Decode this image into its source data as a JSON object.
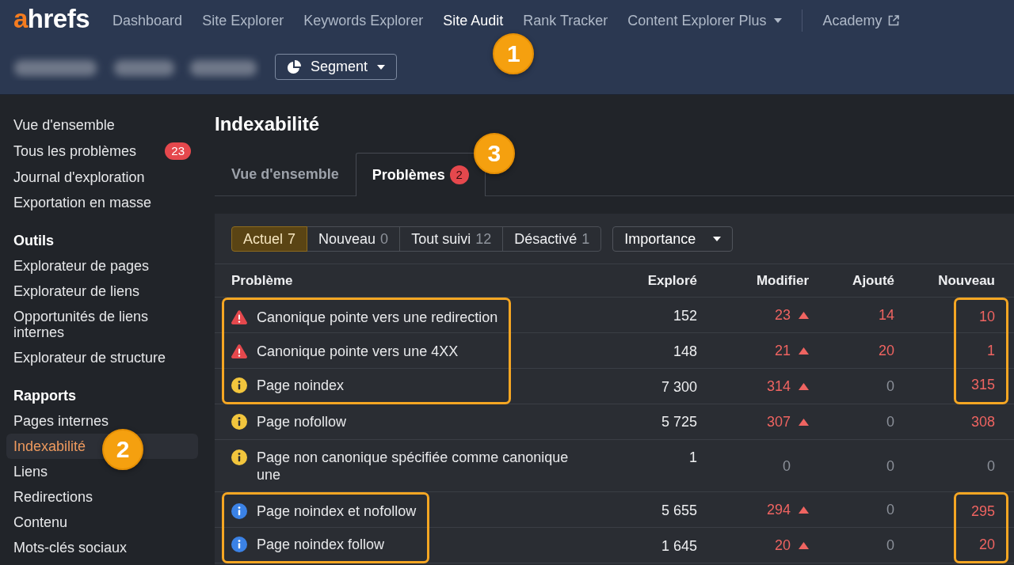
{
  "header": {
    "logo": {
      "accent": "a",
      "rest": "hrefs"
    },
    "nav": [
      {
        "label": "Dashboard",
        "kind": "link",
        "selected": false
      },
      {
        "label": "Site Explorer",
        "kind": "link",
        "selected": false
      },
      {
        "label": "Keywords Explorer",
        "kind": "link",
        "selected": false
      },
      {
        "label": "Site Audit",
        "kind": "link",
        "selected": true,
        "callout": "1"
      },
      {
        "label": "Rank Tracker",
        "kind": "link",
        "selected": false
      },
      {
        "label": "Content Explorer Plus",
        "kind": "dropdown",
        "selected": false
      },
      {
        "label": "Academy",
        "kind": "external",
        "selected": false
      }
    ],
    "segment_button": {
      "label": "Segment"
    }
  },
  "sidebar": {
    "sections": [
      {
        "items": [
          {
            "label": "Vue d'ensemble",
            "selected": false
          },
          {
            "label": "Tous les problèmes",
            "selected": false,
            "badge": "23"
          },
          {
            "label": "Journal d'exploration",
            "selected": false
          },
          {
            "label": "Exportation en masse",
            "selected": false
          }
        ]
      },
      {
        "title": "Outils",
        "items": [
          {
            "label": "Explorateur de pages",
            "selected": false
          },
          {
            "label": "Explorateur de liens",
            "selected": false
          },
          {
            "label": "Opportunités de liens internes",
            "selected": false
          },
          {
            "label": "Explorateur de structure",
            "selected": false
          }
        ]
      },
      {
        "title": "Rapports",
        "items": [
          {
            "label": "Pages internes",
            "selected": false
          },
          {
            "label": "Indexabilité",
            "selected": true,
            "callout": "2"
          },
          {
            "label": "Liens",
            "selected": false
          },
          {
            "label": "Redirections",
            "selected": false
          },
          {
            "label": "Contenu",
            "selected": false
          },
          {
            "label": "Mots-clés sociaux",
            "selected": false
          }
        ]
      }
    ]
  },
  "page_title": "Indexabilité",
  "tabs": [
    {
      "label": "Vue d'ensemble",
      "selected": false
    },
    {
      "label": "Problèmes",
      "selected": true,
      "badge": "2",
      "callout": "3"
    }
  ],
  "filters": [
    {
      "label": "Actuel",
      "count": "7",
      "selected": true
    },
    {
      "label": "Nouveau",
      "count": "0",
      "selected": false
    },
    {
      "label": "Tout suivi",
      "count": "12",
      "selected": false
    },
    {
      "label": "Désactivé",
      "count": "1",
      "selected": false
    }
  ],
  "sort_dropdown": {
    "label": "Importance"
  },
  "table": {
    "columns": [
      "Problème",
      "Exploré",
      "Modifier",
      "Ajouté",
      "Nouveau"
    ],
    "rows": [
      {
        "kind": "error",
        "problem": "Canonique pointe vers une redirection",
        "explored": "152",
        "changed": {
          "value": "23",
          "rising": true
        },
        "added": {
          "value": "14",
          "alert": true
        },
        "new": {
          "value": "10",
          "alert": true
        },
        "highlight": true
      },
      {
        "kind": "error",
        "problem": "Canonique pointe vers une 4XX",
        "explored": "148",
        "changed": {
          "value": "21",
          "rising": true
        },
        "added": {
          "value": "20",
          "alert": true
        },
        "new": {
          "value": "1",
          "alert": true
        },
        "highlight": true
      },
      {
        "kind": "warning",
        "problem": "Page noindex",
        "explored": "7 300",
        "changed": {
          "value": "314",
          "rising": true
        },
        "added": {
          "value": "0",
          "alert": false
        },
        "new": {
          "value": "315",
          "alert": true
        },
        "highlight": true
      },
      {
        "kind": "warning",
        "problem": "Page nofollow",
        "explored": "5 725",
        "changed": {
          "value": "307",
          "rising": true
        },
        "added": {
          "value": "0",
          "alert": false
        },
        "new": {
          "value": "308",
          "alert": true
        },
        "highlight": false
      },
      {
        "kind": "warning",
        "problem": "Page non canonique spécifiée comme canonique une",
        "explored": "1",
        "changed": {
          "value": "0",
          "rising": false
        },
        "added": {
          "value": "0",
          "alert": false
        },
        "new": {
          "value": "0",
          "alert": false
        },
        "highlight": false
      },
      {
        "kind": "notice",
        "problem": "Page noindex et nofollow",
        "explored": "5 655",
        "changed": {
          "value": "294",
          "rising": true
        },
        "added": {
          "value": "0",
          "alert": false
        },
        "new": {
          "value": "295",
          "alert": true
        },
        "highlight": true
      },
      {
        "kind": "notice",
        "problem": "Page noindex follow",
        "explored": "1 645",
        "changed": {
          "value": "20",
          "rising": true
        },
        "added": {
          "value": "0",
          "alert": false
        },
        "new": {
          "value": "20",
          "alert": true
        },
        "highlight": true
      }
    ]
  }
}
